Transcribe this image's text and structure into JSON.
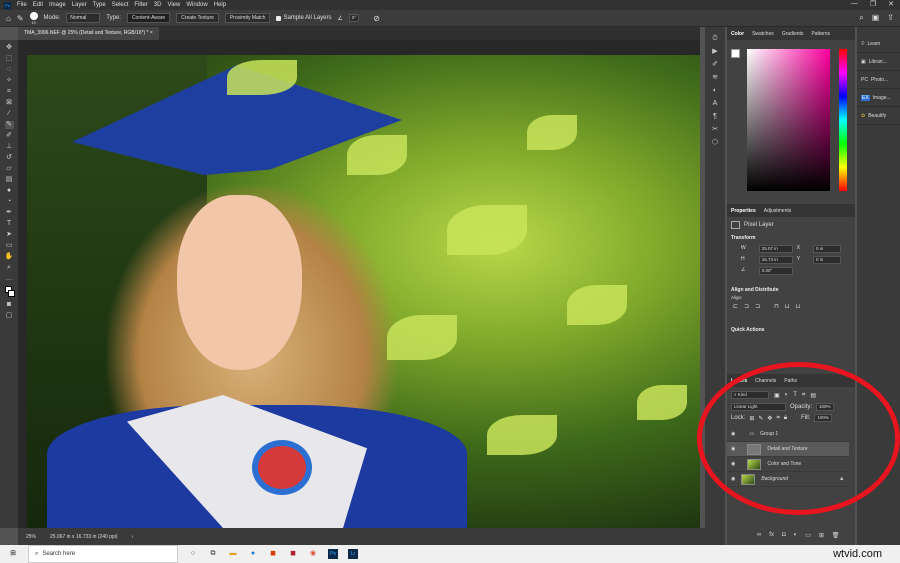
{
  "menu": {
    "logo": "Ps",
    "items": [
      "File",
      "Edit",
      "Image",
      "Layer",
      "Type",
      "Select",
      "Filter",
      "3D",
      "View",
      "Window",
      "Help"
    ]
  },
  "window_controls": [
    "—",
    "❐",
    "✕"
  ],
  "options": {
    "brush_size": "19",
    "mode_label": "Mode:",
    "mode_value": "Normal",
    "type_label": "Type:",
    "type_buttons": [
      "Content-Aware",
      "Create Texture",
      "Proximity Match"
    ],
    "sample_all_layers": "Sample All Layers",
    "angle": "0°"
  },
  "document_tab": "TMA_3996.NEF @ 25% (Detail and Texture, RGB/16*) *",
  "status": {
    "zoom": "25%",
    "doc_size": "25.067 in x 16.733 in (240 ppi)"
  },
  "color_panel": {
    "tabs": [
      "Color",
      "Swatches",
      "Gradients",
      "Patterns"
    ]
  },
  "properties": {
    "tabs": [
      "Properties",
      "Adjustments"
    ],
    "layer_type": "Pixel Layer",
    "transform_label": "Transform",
    "w": "25.07 in",
    "h": "16.73 in",
    "x": "0 in",
    "y": "0 in",
    "angle": "0.00°",
    "align_label": "Align and Distribute",
    "align_sub": "Align:",
    "quick_actions": "Quick Actions"
  },
  "layers": {
    "tabs": [
      "Layers",
      "Channels",
      "Paths"
    ],
    "filter_kind": "Kind",
    "blend_mode": "Linear Light",
    "opacity_label": "Opacity:",
    "opacity": "100%",
    "lock_label": "Lock:",
    "fill_label": "Fill:",
    "fill": "100%",
    "items": [
      {
        "name": "Group 1",
        "type": "group"
      },
      {
        "name": "Detail and Texture",
        "type": "pixel",
        "selected": true
      },
      {
        "name": "Color and Tone",
        "type": "pixel"
      },
      {
        "name": "Background",
        "type": "background"
      }
    ]
  },
  "far_panel": {
    "items": [
      "Learn",
      "Librari...",
      "Photo...",
      "Image...",
      "Beautify"
    ]
  },
  "taskbar": {
    "search_placeholder": "Search here",
    "watermark": "wtvid.com"
  },
  "colors": {
    "highlight_ring": "#e8141e"
  }
}
